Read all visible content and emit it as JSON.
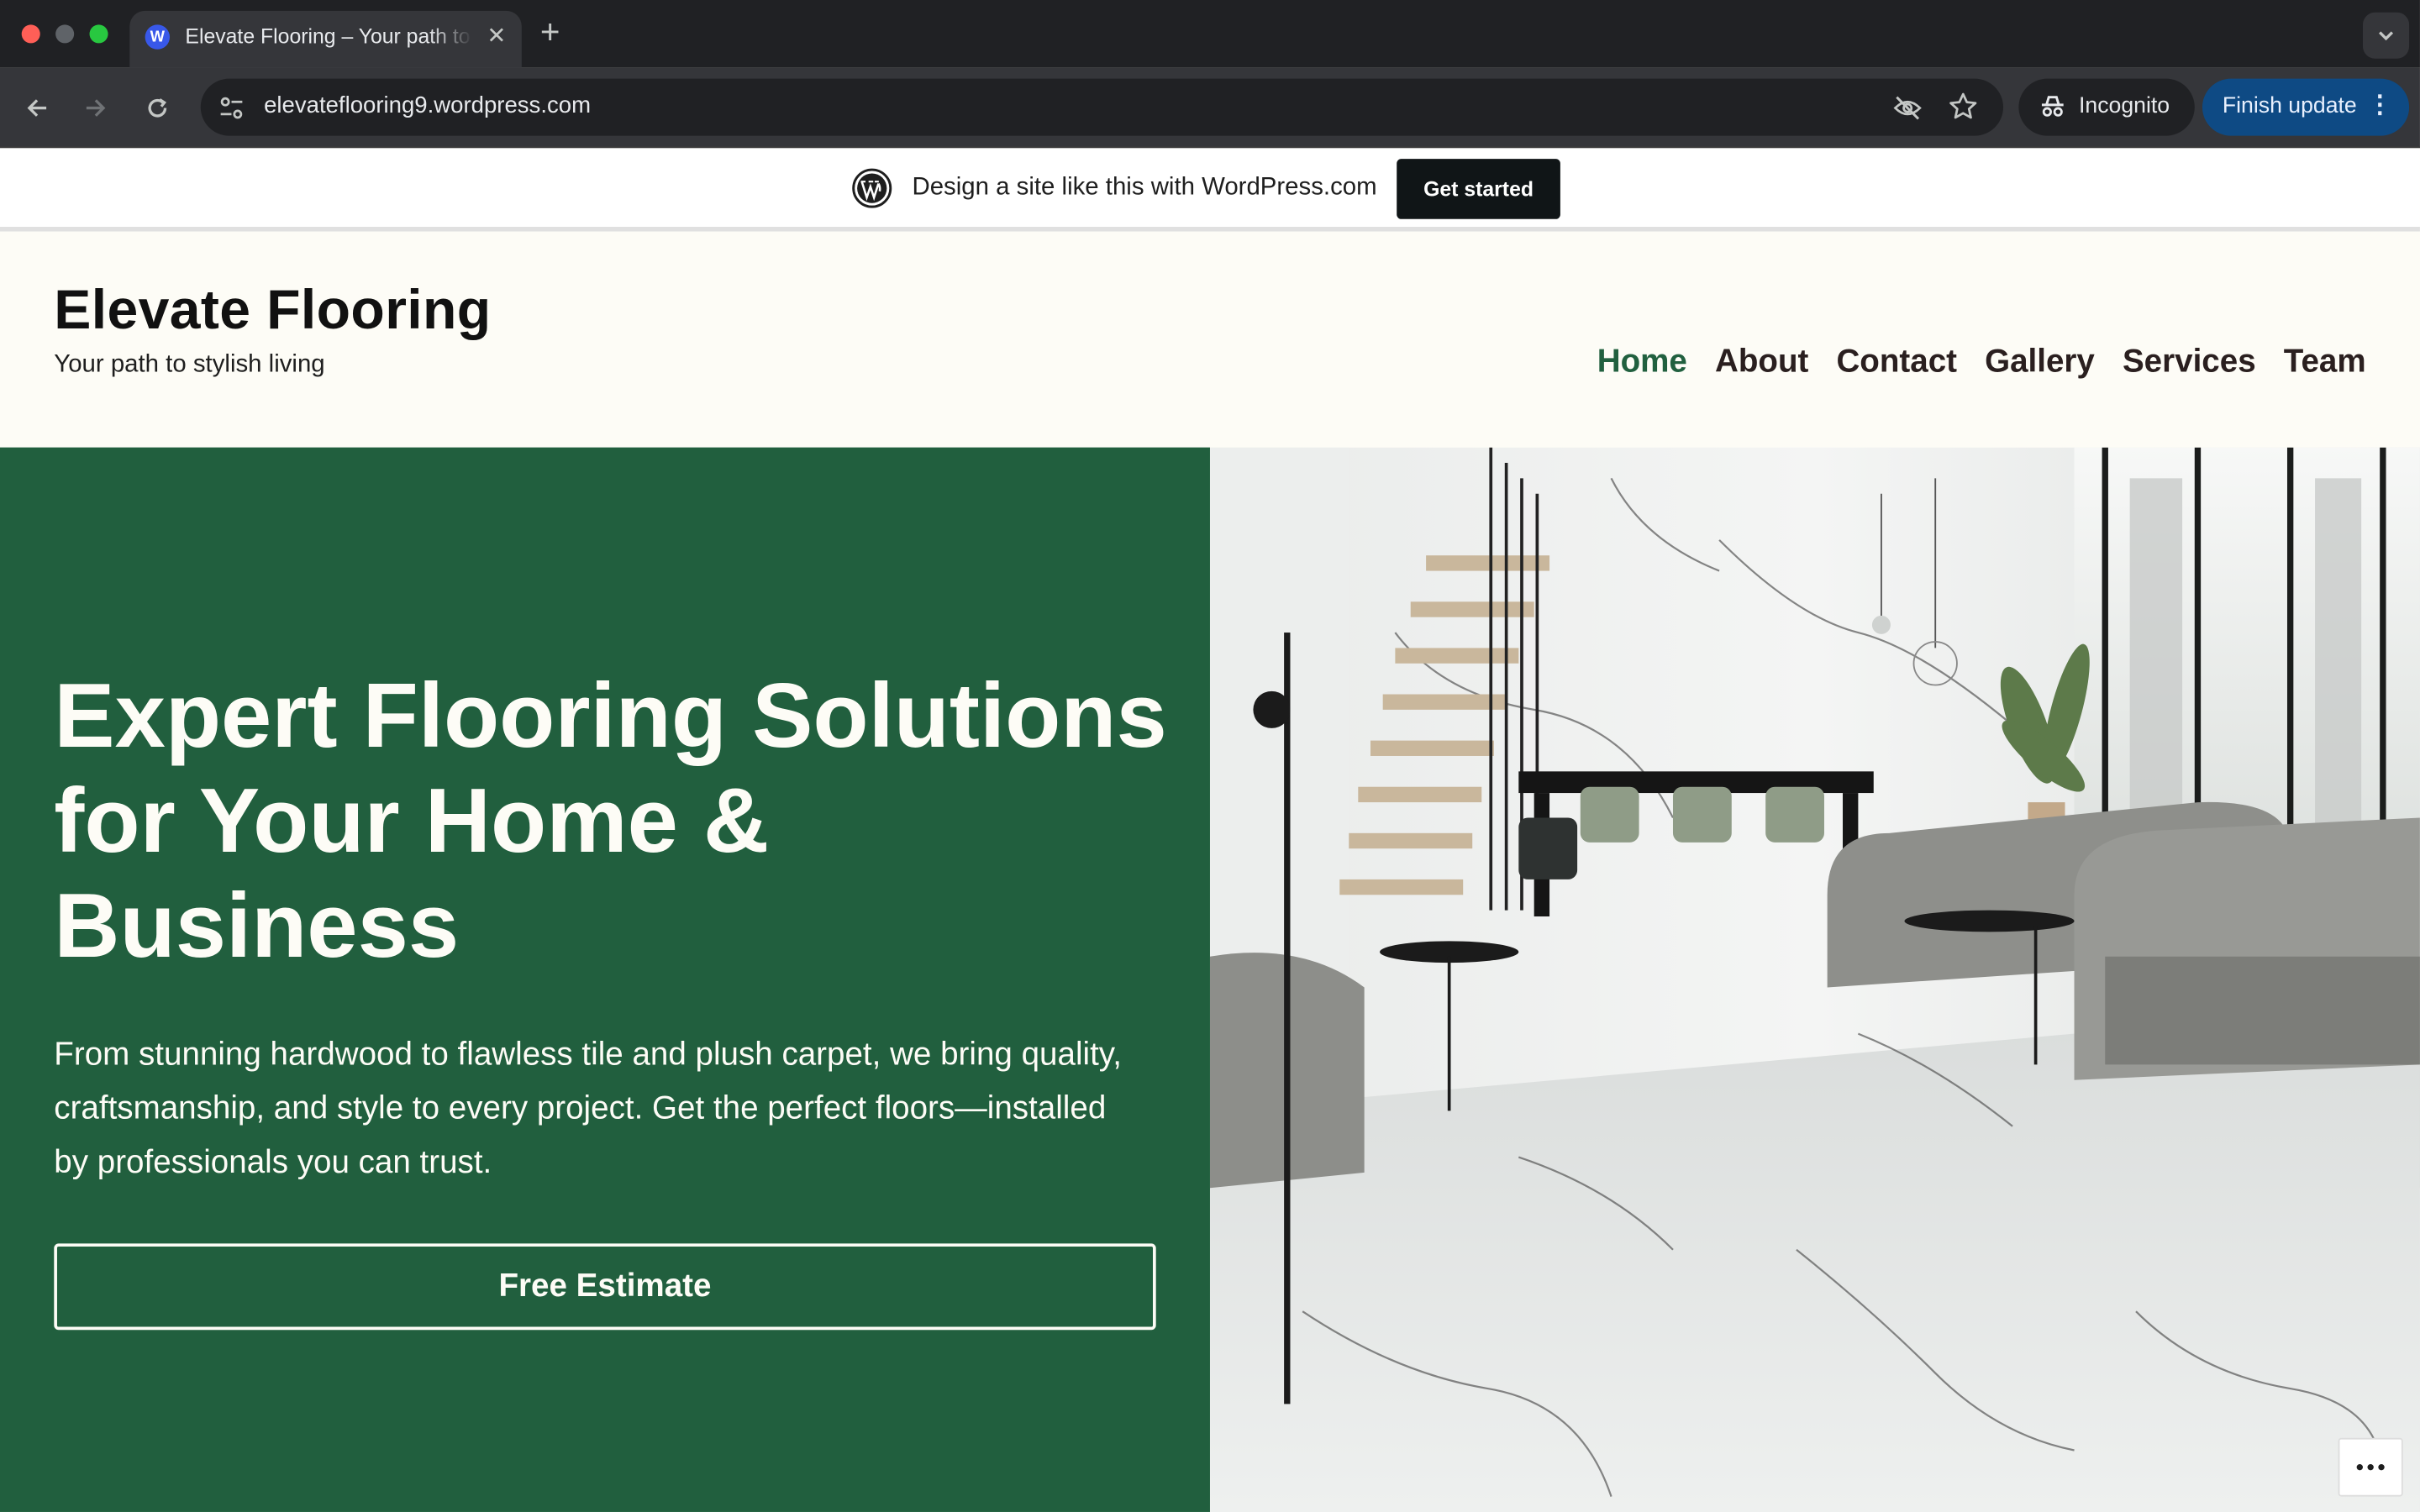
{
  "browser": {
    "tab_title": "Elevate Flooring – Your path to stylish living",
    "favicon": "W",
    "new_tab_symbol": "+",
    "url": "elevateflooring9.wordpress.com",
    "incognito_label": "Incognito",
    "finish_update_label": "Finish update"
  },
  "wp_banner": {
    "text": "Design a site like this with WordPress.com",
    "button": "Get started"
  },
  "site": {
    "title": "Elevate Flooring",
    "tagline": "Your path to stylish living",
    "nav": [
      "Home",
      "About",
      "Contact",
      "Gallery",
      "Services",
      "Team"
    ],
    "active_nav": "Home"
  },
  "hero": {
    "title": "Expert Flooring Solutions for Your Home & Business",
    "text": "From stunning hardwood to flawless tile and plush carpet, we bring quality, craftsmanship, and style to every project. Get the perfect floors—installed by professionals you can trust.",
    "cta": "Free Estimate"
  },
  "colors": {
    "brand_green": "#215f3e",
    "background": "#fdfcf6"
  }
}
